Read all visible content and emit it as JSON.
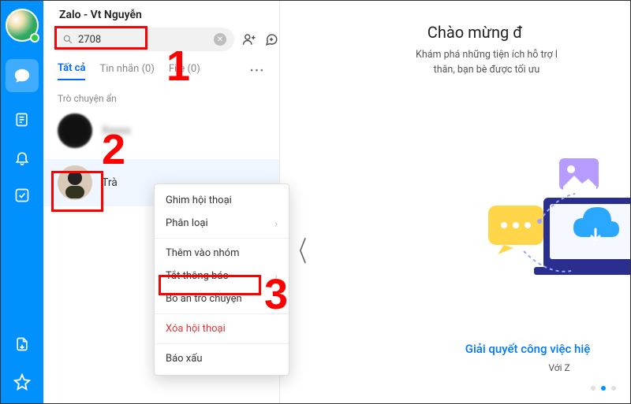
{
  "window_title": "Zalo - Vt Nguyễn",
  "search": {
    "value": "2708",
    "placeholder": ""
  },
  "tabs": [
    {
      "label": "Tất cả",
      "active": true
    },
    {
      "label": "Tin nhắn (0)",
      "active": false
    },
    {
      "label": "File (0)",
      "active": false
    }
  ],
  "section_label": "Trò chuyện ẩn",
  "chats": [
    {
      "name": "Xxxxx"
    },
    {
      "name": "Trà"
    }
  ],
  "context_menu": {
    "pin": "Ghim hội thoại",
    "classify": "Phân loại",
    "add_group": "Thêm vào nhóm",
    "mute": "Tắt thông báo",
    "unhide": "Bỏ ẩn trò chuyện",
    "delete": "Xóa hội thoại",
    "report": "Báo xấu"
  },
  "welcome": {
    "title": "Chào mừng đ",
    "subtitle_l1": "Khám phá những tiện ích hỗ trợ l",
    "subtitle_l2": "thân, bạn bè được tối ưu",
    "feature_title": "Giải quyết công việc hiệ",
    "feature_sub": "Với Z"
  },
  "annotations": {
    "n1": "1",
    "n2": "2",
    "n3": "3"
  },
  "icons": {
    "chat": "chat-icon",
    "contacts": "contacts-icon",
    "bell": "bell-icon",
    "check": "check-square-icon",
    "share": "share-out-icon",
    "star": "star-icon",
    "search": "search-icon",
    "clear": "close-icon",
    "add_friend": "add-friend-icon",
    "chat_compose": "compose-chat-icon",
    "chevron": "chevron-right-icon"
  }
}
